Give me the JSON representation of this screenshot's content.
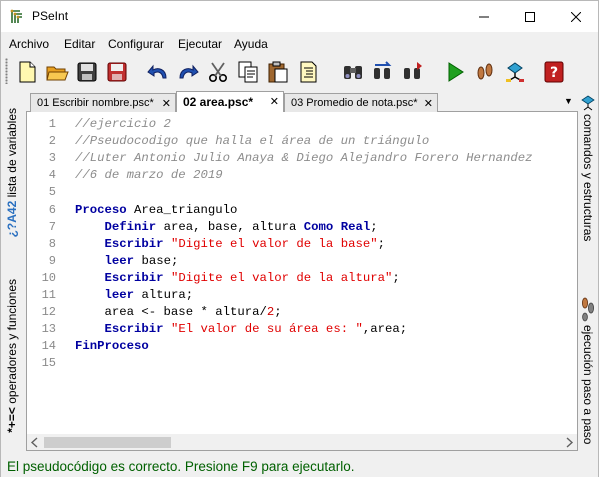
{
  "window": {
    "title": "PSeInt",
    "minimize_glyph": "—",
    "maximize_glyph": "☐",
    "close_glyph": "✕"
  },
  "menu": {
    "items": [
      "Archivo",
      "Editar",
      "Configurar",
      "Ejecutar",
      "Ayuda"
    ]
  },
  "toolbar": {
    "icons": [
      "new-file-icon",
      "open-folder-icon",
      "save-icon",
      "save-as-icon",
      "undo-icon",
      "redo-icon",
      "cut-icon",
      "copy-icon",
      "paste-icon",
      "indent-icon",
      "find-icon",
      "find-replace-icon",
      "find-next-icon",
      "run-icon",
      "step-by-step-icon",
      "flowchart-icon",
      "help-icon"
    ]
  },
  "left_panel": {
    "variables_label": "lista de variables",
    "variables_icon": "*+=<",
    "variables_icon_top": "¿?A42",
    "operators_label": "operadores y funciones",
    "operators_icon": "*+=<"
  },
  "right_panel": {
    "commands_label": "comandos y estructuras",
    "step_label": "ejecución paso a paso"
  },
  "tabs": [
    {
      "label": "01 Escribir nombre.psc*",
      "close": "✕",
      "active": false
    },
    {
      "label": "02 area.psc*",
      "close": "✕",
      "active": true
    },
    {
      "label": "03 Promedio de nota.psc*",
      "close": "✕",
      "active": false
    }
  ],
  "tab_menu_glyph": "▼",
  "editor": {
    "line_numbers": [
      "1",
      "2",
      "3",
      "4",
      "5",
      "6",
      "7",
      "8",
      "9",
      "10",
      "11",
      "12",
      "13",
      "14",
      "15"
    ],
    "lines": [
      [
        {
          "t": "//ejercicio 2",
          "c": "cm"
        }
      ],
      [
        {
          "t": "//Pseudocodigo que halla el área de un triángulo",
          "c": "cm"
        }
      ],
      [
        {
          "t": "//Luter Antonio Julio Anaya & Diego Alejandro Forero Hernandez",
          "c": "cm"
        }
      ],
      [
        {
          "t": "//6 de marzo de 2019",
          "c": "cm"
        }
      ],
      [],
      [
        {
          "t": "Proceso",
          "c": "kw"
        },
        {
          "t": " Area_triangulo",
          "c": ""
        }
      ],
      [
        {
          "t": "    ",
          "c": ""
        },
        {
          "t": "Definir",
          "c": "kw"
        },
        {
          "t": " area, base, altura ",
          "c": ""
        },
        {
          "t": "Como",
          "c": "kw"
        },
        {
          "t": " ",
          "c": ""
        },
        {
          "t": "Real",
          "c": "kw"
        },
        {
          "t": ";",
          "c": ""
        }
      ],
      [
        {
          "t": "    ",
          "c": ""
        },
        {
          "t": "Escribir",
          "c": "kw"
        },
        {
          "t": " ",
          "c": ""
        },
        {
          "t": "\"Digite el valor de la base\"",
          "c": "str"
        },
        {
          "t": ";",
          "c": ""
        }
      ],
      [
        {
          "t": "    ",
          "c": ""
        },
        {
          "t": "leer",
          "c": "kw"
        },
        {
          "t": " base;",
          "c": ""
        }
      ],
      [
        {
          "t": "    ",
          "c": ""
        },
        {
          "t": "Escribir",
          "c": "kw"
        },
        {
          "t": " ",
          "c": ""
        },
        {
          "t": "\"Digite el valor de la altura\"",
          "c": "str"
        },
        {
          "t": ";",
          "c": ""
        }
      ],
      [
        {
          "t": "    ",
          "c": ""
        },
        {
          "t": "leer",
          "c": "kw"
        },
        {
          "t": " altura;",
          "c": ""
        }
      ],
      [
        {
          "t": "    area <- base * altura/",
          "c": ""
        },
        {
          "t": "2",
          "c": "num"
        },
        {
          "t": ";",
          "c": ""
        }
      ],
      [
        {
          "t": "    ",
          "c": ""
        },
        {
          "t": "Escribir",
          "c": "kw"
        },
        {
          "t": " ",
          "c": ""
        },
        {
          "t": "\"El valor de su área es: \"",
          "c": "str"
        },
        {
          "t": ",area;",
          "c": ""
        }
      ],
      [
        {
          "t": "FinProceso",
          "c": "kw"
        }
      ],
      []
    ]
  },
  "scrollbar": {
    "left_glyph": "<",
    "right_glyph": ">"
  },
  "status": {
    "text": "El pseudocódigo es correcto. Presione F9 para ejecutarlo.",
    "color": "#006000"
  },
  "colors": {
    "comment": "#8c8c8c",
    "keyword": "#0000a0",
    "string": "#e00000"
  }
}
